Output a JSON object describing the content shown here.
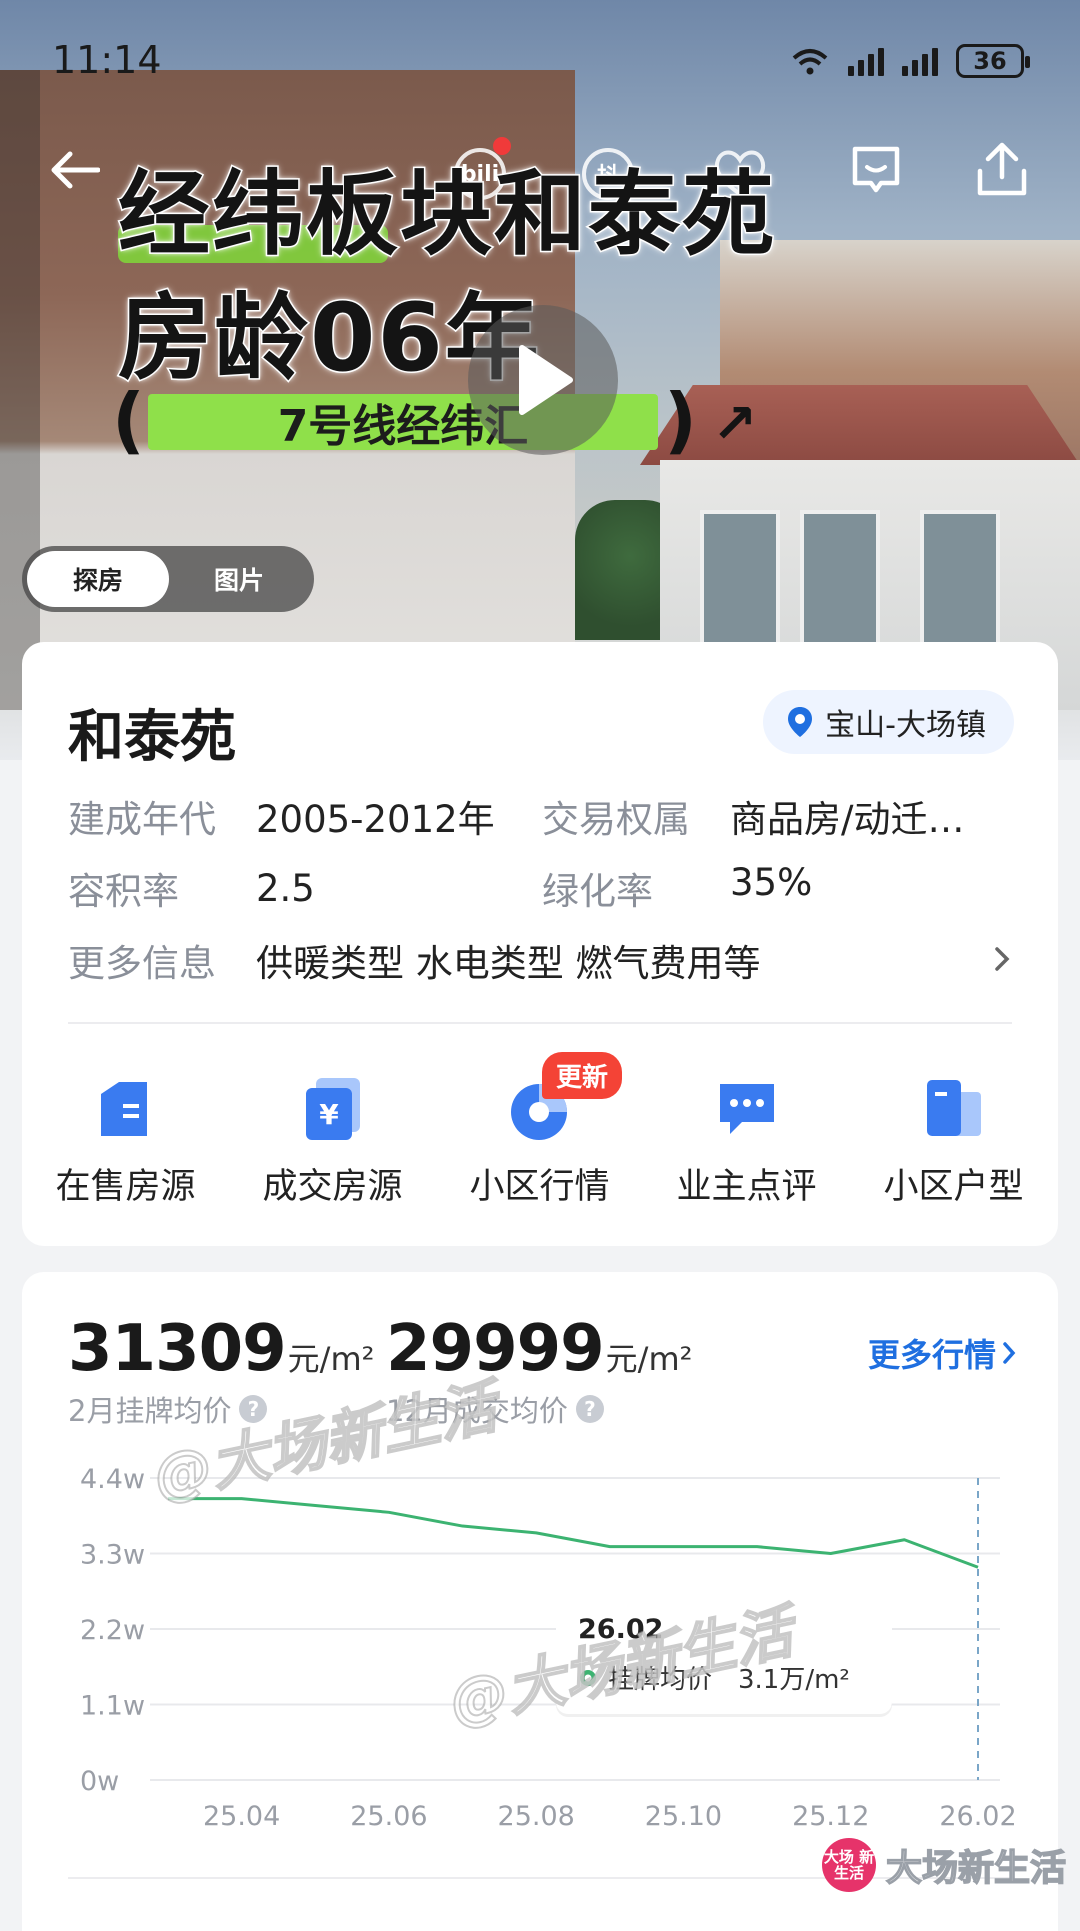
{
  "status_bar": {
    "time": "11:14",
    "battery": "36",
    "network": "6"
  },
  "video": {
    "title_line1": "经纬板块和泰苑",
    "title_line2": "房龄06年",
    "metro": "7号线经纬汇",
    "paren_open": "(",
    "paren_close": ")",
    "overlay_icon_1": "bili",
    "overlay_icon_2": "抖",
    "icons": [
      "back-arrow-icon",
      "chat-icon",
      "share-icon",
      "play-icon"
    ]
  },
  "media_tabs": [
    {
      "label": "探房",
      "active": true
    },
    {
      "label": "图片",
      "active": false
    }
  ],
  "community": {
    "name": "和泰苑",
    "location": "宝山-大场镇",
    "rows": [
      {
        "label": "建成年代",
        "value": "2005-2012年",
        "label2": "交易权属",
        "value2": "商品房/动迁…"
      },
      {
        "label": "容积率",
        "value": "2.5",
        "label2": "绿化率",
        "value2": "35%"
      },
      {
        "label": "更多信息",
        "value": "供暖类型 水电类型 燃气费用等"
      }
    ]
  },
  "actions": [
    {
      "label": "在售房源",
      "icon": "listing-icon"
    },
    {
      "label": "成交房源",
      "icon": "deal-yuan-icon"
    },
    {
      "label": "小区行情",
      "icon": "market-pie-icon",
      "badge": "更新"
    },
    {
      "label": "业主点评",
      "icon": "comment-bubble-icon"
    },
    {
      "label": "小区户型",
      "icon": "floorplan-icon"
    }
  ],
  "prices": {
    "listing": {
      "value": "31309",
      "unit": "元/m²",
      "label": "2月挂牌均价"
    },
    "deal": {
      "value": "29999",
      "unit": "元/m²",
      "label": "12月成交均价"
    },
    "more_label": "更多行情"
  },
  "chart_data": {
    "type": "line",
    "y_ticks": [
      "4.4w",
      "3.3w",
      "2.2w",
      "1.1w",
      "0w"
    ],
    "ylim": [
      0,
      4.4
    ],
    "x_ticks": [
      "25.04",
      "25.06",
      "25.08",
      "25.10",
      "25.12",
      "26.02"
    ],
    "x": [
      "25.03",
      "25.04",
      "25.05",
      "25.06",
      "25.07",
      "25.08",
      "25.09",
      "25.10",
      "25.11",
      "25.12",
      "26.01",
      "26.02"
    ],
    "series": [
      {
        "name": "挂牌均价",
        "color": "#3cb371",
        "values": [
          4.1,
          4.1,
          4.0,
          3.9,
          3.7,
          3.6,
          3.4,
          3.4,
          3.4,
          3.3,
          3.5,
          3.1
        ]
      }
    ],
    "tooltip": {
      "title": "26.02",
      "series": "挂牌均价",
      "value": "3.1万/m²"
    },
    "grid": true
  },
  "watermarks": {
    "text": "@大场新生活",
    "brand": "大场新生活",
    "brand_logo": "大场 新生活"
  }
}
